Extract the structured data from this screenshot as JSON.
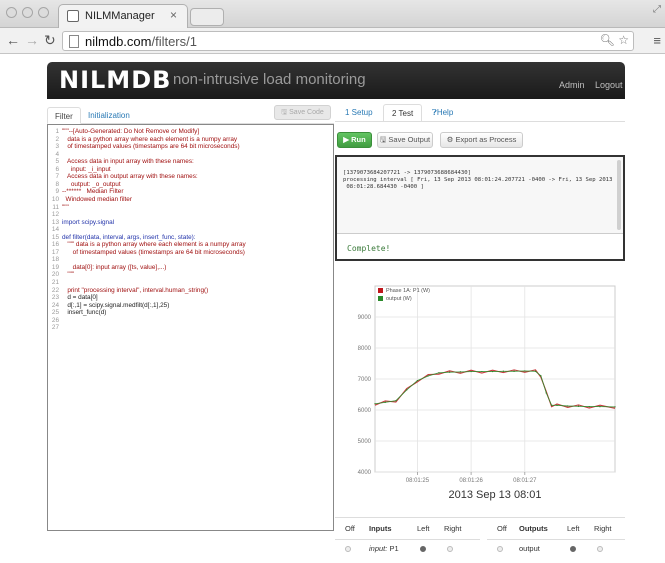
{
  "browser": {
    "tab_title": "NILMManager",
    "tab_close": "×",
    "url_host": "nilmdb.com",
    "url_path": "/filters/1"
  },
  "header": {
    "logo": "NILMDB",
    "tagline": "non-intrusive load monitoring",
    "admin_label": "Admin",
    "logout_label": "Logout"
  },
  "left": {
    "tabs": [
      {
        "label": "Filter"
      },
      {
        "label": "Initialization"
      }
    ],
    "save_code_label": "Save Code",
    "code_lines": [
      {
        "n": "1",
        "text": "\"\"\"--[Auto-Generated: Do Not Remove or Modify]",
        "cls": "c-red"
      },
      {
        "n": "2",
        "text": "   data is a python array where each element is a numpy array",
        "cls": "c-red"
      },
      {
        "n": "3",
        "text": "   of timestamped values (timestamps are 64 bit microseconds)",
        "cls": "c-red"
      },
      {
        "n": "4",
        "text": "",
        "cls": "c-red"
      },
      {
        "n": "5",
        "text": "   Access data in input array with these names:",
        "cls": "c-red"
      },
      {
        "n": "6",
        "text": "     input: _i_input",
        "cls": "c-red"
      },
      {
        "n": "7",
        "text": "   Access data in output array with these names:",
        "cls": "c-red"
      },
      {
        "n": "8",
        "text": "     output: _o_output",
        "cls": "c-red"
      },
      {
        "n": "9",
        "text": "--******   Median Filter",
        "cls": "c-red"
      },
      {
        "n": "10",
        "text": "  Windowed median filter",
        "cls": "c-red"
      },
      {
        "n": "11",
        "text": "\"\"\"",
        "cls": "c-red"
      },
      {
        "n": "12",
        "text": "",
        "cls": "c-dark"
      },
      {
        "n": "13",
        "text": "import scipy.signal",
        "cls": "c-blue"
      },
      {
        "n": "14",
        "text": "",
        "cls": "c-dark"
      },
      {
        "n": "15",
        "text": "def filter(data, interval, args, insert_func, state):",
        "cls": "c-blue"
      },
      {
        "n": "16",
        "text": "   \"\"\" data is a python array where each element is a numpy array",
        "cls": "c-red"
      },
      {
        "n": "17",
        "text": "      of timestamped values (timestamps are 64 bit microseconds)",
        "cls": "c-red"
      },
      {
        "n": "18",
        "text": "",
        "cls": "c-red"
      },
      {
        "n": "19",
        "text": "      data[0]: input array ([ts, value],...)",
        "cls": "c-red"
      },
      {
        "n": "20",
        "text": "   \"\"\"",
        "cls": "c-red"
      },
      {
        "n": "21",
        "text": "",
        "cls": "c-dark"
      },
      {
        "n": "22",
        "text": "   print \"processing interval\", interval.human_string()",
        "cls": "c-red"
      },
      {
        "n": "23",
        "text": "   d = data[0]",
        "cls": "c-dark"
      },
      {
        "n": "24",
        "text": "   d[:,1] = scipy.signal.medfilt(d[:,1],25)",
        "cls": "c-dark"
      },
      {
        "n": "25",
        "text": "   insert_func(d)",
        "cls": "c-dark"
      },
      {
        "n": "26",
        "text": "",
        "cls": "c-dark"
      },
      {
        "n": "27",
        "text": "",
        "cls": "c-dark"
      }
    ]
  },
  "right": {
    "tabs": [
      {
        "label": "1 Setup"
      },
      {
        "label": "2 Test"
      },
      {
        "label": "Help"
      }
    ],
    "run_label": "Run",
    "save_output_label": "Save Output",
    "export_label": "Export as Process",
    "console_lines": [
      "[1379073684207721 -> 1379073688684430]",
      "processing interval [ Fri, 13 Sep 2013 08:01:24.207721 -0400 -> Fri, 13 Sep 2013",
      " 08:01:28.684430 -0400 ]"
    ],
    "console_status": "Complete!"
  },
  "chart_data": {
    "type": "line",
    "title": "",
    "xlabel": "2013 Sep 13 08:01",
    "ylabel": "",
    "ylim": [
      4000,
      10000
    ],
    "yticks": [
      "4000",
      "5000",
      "6000",
      "7000",
      "8000",
      "9000"
    ],
    "xticks": [
      "08:01:25",
      "08:01:26",
      "08:01:27"
    ],
    "x_tick_values": [
      25,
      26,
      27
    ],
    "xlim": [
      24.21,
      28.68
    ],
    "legend": [
      {
        "name": "Phase 1A: P1 (W)",
        "color": "#c0161b"
      },
      {
        "name": "output (W)",
        "color": "#2a8a2a"
      }
    ],
    "grid": true,
    "series": [
      {
        "name": "Phase 1A: P1 (W)",
        "color": "#c0161b",
        "x": [
          24.21,
          24.4,
          24.6,
          24.8,
          25.0,
          25.2,
          25.4,
          25.6,
          25.8,
          26.0,
          26.2,
          26.4,
          26.6,
          26.8,
          27.0,
          27.2,
          27.3,
          27.4,
          27.5,
          27.6,
          27.8,
          28.0,
          28.2,
          28.4,
          28.68
        ],
        "y": [
          6200,
          6250,
          6300,
          6650,
          6950,
          7100,
          7200,
          7220,
          7230,
          7240,
          7240,
          7240,
          7250,
          7250,
          7260,
          7250,
          7100,
          6550,
          6150,
          6150,
          6130,
          6120,
          6110,
          6110,
          6100
        ]
      },
      {
        "name": "output (W)",
        "color": "#2a8a2a",
        "x": [
          24.21,
          24.4,
          24.6,
          24.8,
          25.0,
          25.2,
          25.4,
          25.6,
          25.8,
          26.0,
          26.2,
          26.4,
          26.6,
          26.8,
          27.0,
          27.2,
          27.3,
          27.4,
          27.5,
          27.6,
          27.8,
          28.0,
          28.2,
          28.4,
          28.68
        ],
        "y": [
          6200,
          6250,
          6300,
          6650,
          6950,
          7100,
          7200,
          7220,
          7230,
          7240,
          7240,
          7240,
          7250,
          7250,
          7260,
          7250,
          7100,
          6550,
          6150,
          6150,
          6130,
          6120,
          6110,
          6110,
          6100
        ]
      }
    ]
  },
  "io": {
    "inputs_header": {
      "off": "Off",
      "title": "Inputs",
      "left": "Left",
      "right": "Right"
    },
    "outputs_header": {
      "off": "Off",
      "title": "Outputs",
      "left": "Left",
      "right": "Right"
    },
    "inputs": [
      {
        "prefix": "input:",
        "name": "P1",
        "selected": "left"
      }
    ],
    "outputs": [
      {
        "name": "output",
        "selected": "left"
      }
    ]
  }
}
